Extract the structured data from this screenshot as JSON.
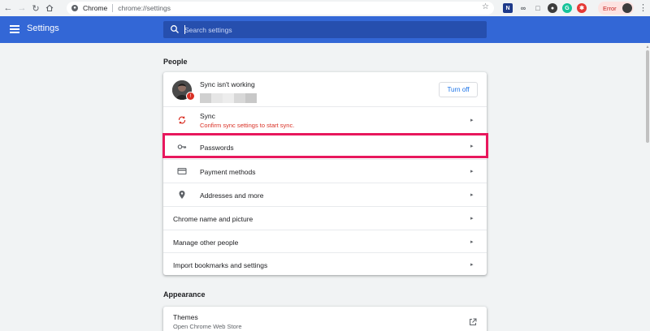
{
  "browser": {
    "origin_label": "Chrome",
    "url": "chrome://settings",
    "error_label": "Error",
    "extensions": [
      "N-icon",
      "link-icon",
      "comment-icon",
      "shield-icon",
      "grammarly-icon",
      "bug-icon"
    ]
  },
  "header": {
    "title": "Settings",
    "search_placeholder": "Search settings"
  },
  "people": {
    "section_title": "People",
    "profile": {
      "status": "Sync isn't working",
      "turn_off_label": "Turn off"
    },
    "sync": {
      "label": "Sync",
      "sublabel": "Confirm sync settings to start sync."
    },
    "passwords": {
      "label": "Passwords"
    },
    "payment_methods": {
      "label": "Payment methods"
    },
    "addresses": {
      "label": "Addresses and more"
    },
    "chrome_name": {
      "label": "Chrome name and picture"
    },
    "manage_people": {
      "label": "Manage other people"
    },
    "import": {
      "label": "Import bookmarks and settings"
    }
  },
  "appearance": {
    "section_title": "Appearance",
    "themes": {
      "label": "Themes",
      "sublabel": "Open Chrome Web Store"
    }
  },
  "colors": {
    "header_blue": "#3367d6",
    "highlight": "#e8175d",
    "error_red": "#d93025",
    "link_blue": "#1a73e8"
  }
}
